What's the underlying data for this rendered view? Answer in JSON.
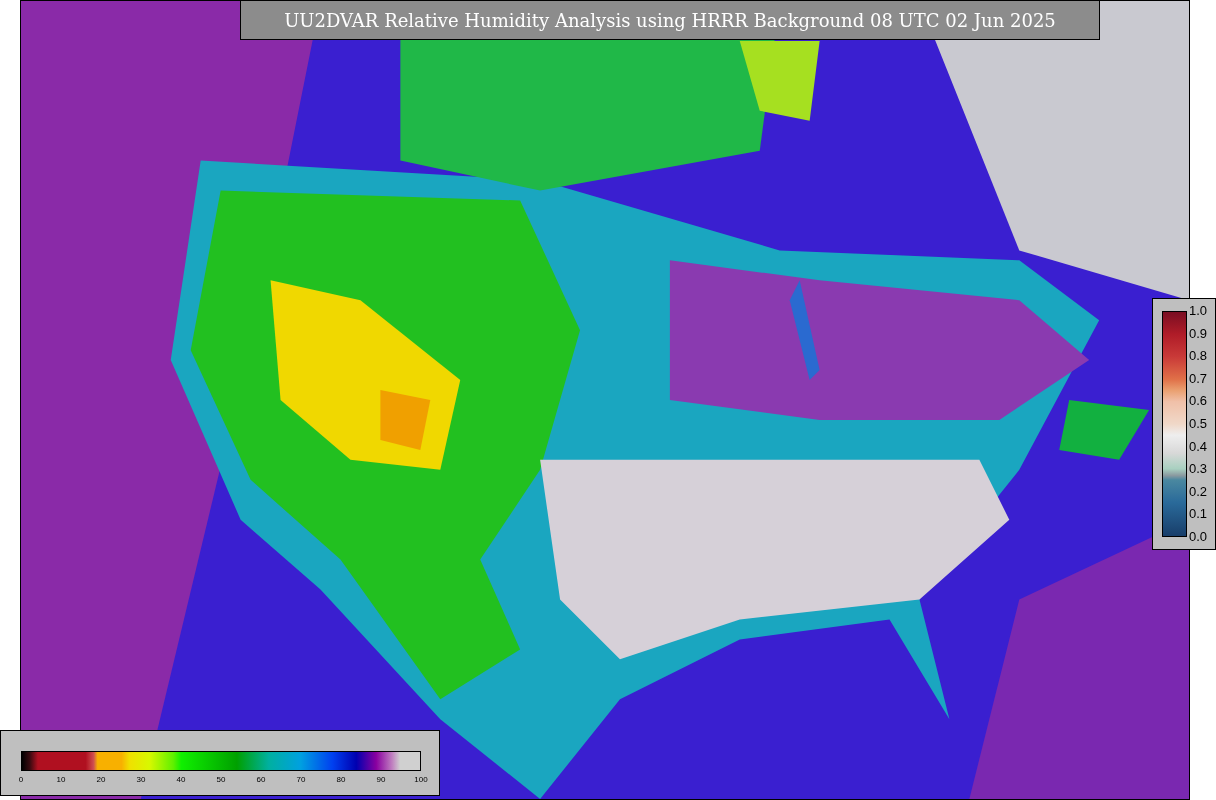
{
  "title": "UU2DVAR Relative Humidity Analysis using HRRR Background 08 UTC 02 Jun 2025",
  "ratio_legend": {
    "ticks": [
      "1.0",
      "0.9",
      "0.8",
      "0.7",
      "0.6",
      "0.5",
      "0.4",
      "0.3",
      "0.2",
      "0.1",
      "0.0"
    ]
  },
  "humidity_legend": {
    "ticks": [
      "0",
      "10",
      "20",
      "30",
      "40",
      "50",
      "60",
      "70",
      "80",
      "90",
      "100"
    ]
  }
}
